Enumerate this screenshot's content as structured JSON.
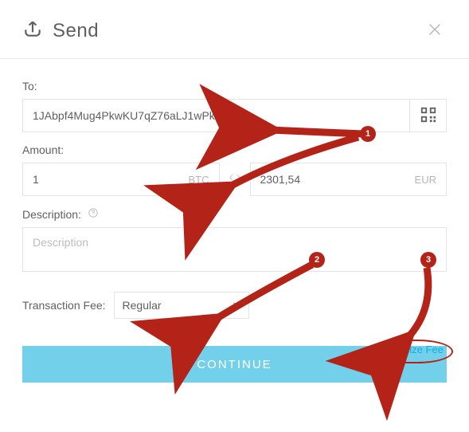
{
  "header": {
    "title": "Send"
  },
  "to": {
    "label": "To:",
    "value": "1JAbpf4Mug4PkwKU7qZ76aLJ1wPkthq3rY"
  },
  "amount": {
    "label": "Amount:",
    "crypto_value": "1",
    "crypto_unit": "BTC",
    "fiat_value": "2301,54",
    "fiat_unit": "EUR"
  },
  "description": {
    "label": "Description:",
    "placeholder": "Description"
  },
  "fee": {
    "label": "Transaction Fee:",
    "selected": "Regular",
    "customize_label": "Customize Fee"
  },
  "actions": {
    "continue": "CONTINUE"
  },
  "annotations": {
    "b1": "1",
    "b2": "2",
    "b3": "3"
  }
}
